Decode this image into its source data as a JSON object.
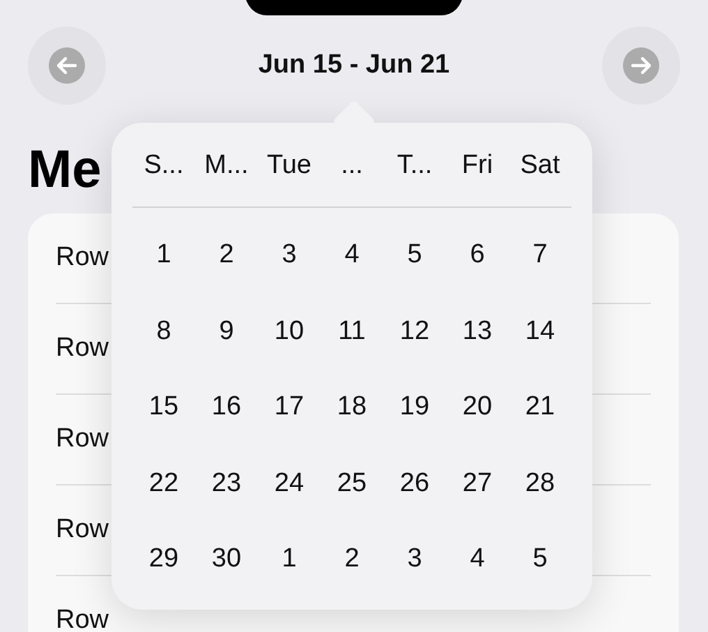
{
  "header": {
    "title": "Jun 15 - Jun 21"
  },
  "page_title": "Me",
  "list": {
    "rows": [
      "Row",
      "Row",
      "Row",
      "Row",
      "Row"
    ]
  },
  "popover": {
    "weekdays": [
      "S...",
      "M...",
      "Tue",
      "...",
      "T...",
      "Fri",
      "Sat"
    ],
    "weeks": [
      [
        "1",
        "2",
        "3",
        "4",
        "5",
        "6",
        "7"
      ],
      [
        "8",
        "9",
        "10",
        "11",
        "12",
        "13",
        "14"
      ],
      [
        "15",
        "16",
        "17",
        "18",
        "19",
        "20",
        "21"
      ],
      [
        "22",
        "23",
        "24",
        "25",
        "26",
        "27",
        "28"
      ],
      [
        "29",
        "30",
        "1",
        "2",
        "3",
        "4",
        "5"
      ]
    ]
  }
}
